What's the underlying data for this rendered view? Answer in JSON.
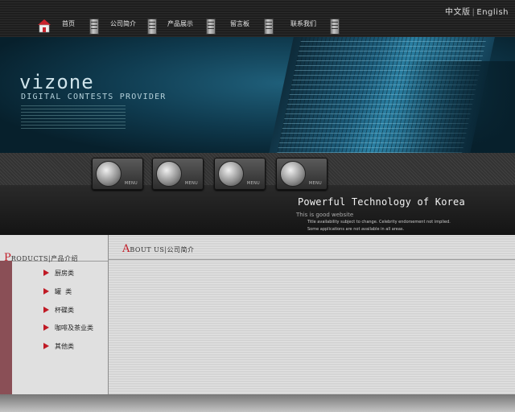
{
  "lang": {
    "chinese": "中文版",
    "separator": "|",
    "english": "English"
  },
  "nav": [
    {
      "label": "首页"
    },
    {
      "label": "公司简介"
    },
    {
      "label": "产品展示"
    },
    {
      "label": "留言板"
    },
    {
      "label": "联系我们"
    }
  ],
  "banner": {
    "logo": "vizone",
    "tagline": "DIGITAL CONTESTS PROVIDER"
  },
  "menu_buttons": [
    {
      "label": "MENU",
      "icon": "phone-icon"
    },
    {
      "label": "MENU",
      "icon": "device-icon"
    },
    {
      "label": "MENU",
      "icon": "printer-icon"
    },
    {
      "label": "MENU",
      "icon": "padlock-icon"
    }
  ],
  "promo": {
    "slogan": "Powerful Technology of Korea",
    "line1": "This is good website",
    "line2": "Title availability subject to change. Celebrity endorsement not implied.",
    "line3": "Some applications are not available in all areas."
  },
  "sidebar": {
    "initial": "P",
    "title": "RODUCTS|产品介绍",
    "items": [
      {
        "label": "厨房类"
      },
      {
        "label": "罐  类"
      },
      {
        "label": "杯碟类"
      },
      {
        "label": "咖啡及茶业类"
      },
      {
        "label": "其他类"
      }
    ]
  },
  "main": {
    "initial": "A",
    "title": "BOUT US|公司简介"
  },
  "colors": {
    "accent_red": "#c01a25",
    "sidebar_strip": "#8a4f56",
    "banner_blue": "#1f5f7a"
  }
}
